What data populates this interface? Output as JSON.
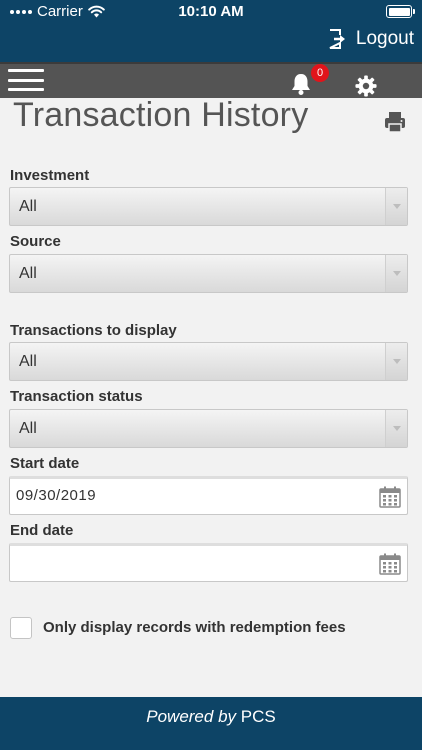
{
  "status_bar": {
    "carrier": "Carrier",
    "time": "10:10 AM"
  },
  "header": {
    "logout_label": "Logout"
  },
  "nav": {
    "notification_count": "0"
  },
  "page": {
    "title": "Transaction History"
  },
  "filters": {
    "investment": {
      "label": "Investment",
      "value": "All"
    },
    "source": {
      "label": "Source",
      "value": "All"
    },
    "transactions_to_display": {
      "label": "Transactions to display",
      "value": "All"
    },
    "transaction_status": {
      "label": "Transaction status",
      "value": "All"
    },
    "start_date": {
      "label": "Start date",
      "value": "09/30/2019"
    },
    "end_date": {
      "label": "End date",
      "value": ""
    },
    "redemption_fees": {
      "label": "Only display records with redemption fees",
      "checked": false
    }
  },
  "footer": {
    "powered_by": "Powered by",
    "brand": "PCS"
  },
  "colors": {
    "primary": "#0d4466",
    "nav": "#545454",
    "badge": "#e1141b",
    "background": "#f2f2f2"
  }
}
